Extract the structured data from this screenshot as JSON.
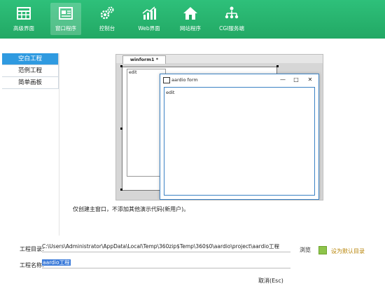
{
  "toolbar": {
    "items": [
      {
        "label": "高级界面",
        "icon": "grid-window-icon"
      },
      {
        "label": "窗口程序",
        "icon": "window-form-icon",
        "active": true
      },
      {
        "label": "控制台",
        "icon": "gears-icon"
      },
      {
        "label": "Web界面",
        "icon": "bar-chart-icon"
      },
      {
        "label": "网站程序",
        "icon": "home-icon"
      },
      {
        "label": "CGI服务端",
        "icon": "org-chart-icon"
      }
    ]
  },
  "sidebar": {
    "items": [
      {
        "label": "空白工程",
        "active": true
      },
      {
        "label": "范例工程"
      },
      {
        "label": "简单画板"
      }
    ]
  },
  "preview": {
    "tab_label": "winform1 *",
    "editor_text": "edit",
    "window_title": "aardio form",
    "window_body_text": "edit"
  },
  "note": "仅创建主窗口，不添加其他演示代码(新用户)。",
  "form": {
    "dir_label": "工程目录:",
    "dir_value": "C:\\Users\\Administrator\\AppData\\Local\\Temp\\360zip$Temp\\360$0\\aardio\\project\\aardio工程",
    "browse_label": "浏览",
    "default_dir_label": "设为默认目录",
    "name_label": "工程名称:",
    "name_value": "aardio工程",
    "cancel_label": "取消(Esc)"
  },
  "colors": {
    "toolbar": "#22a864",
    "sidebar_active": "#2f9ae0",
    "accent_window": "#3b82c4",
    "default_link": "#b8860b"
  }
}
